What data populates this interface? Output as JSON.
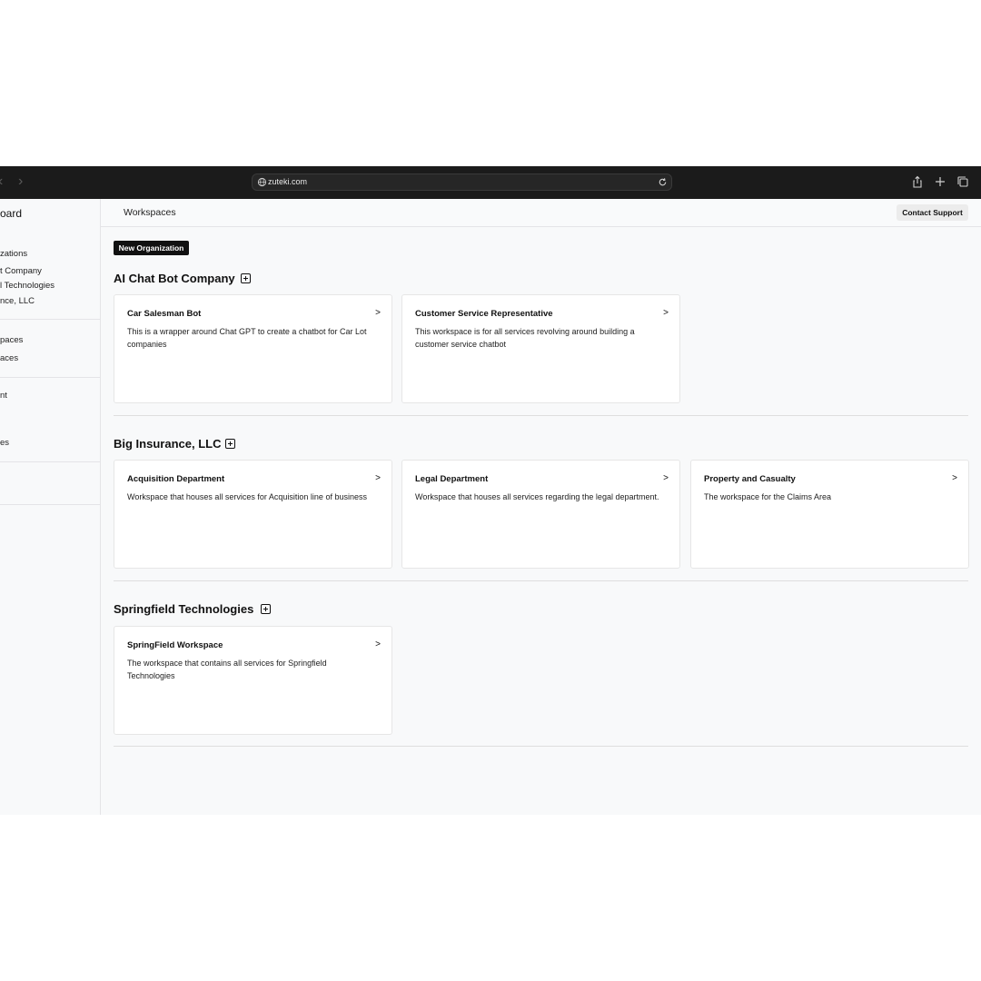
{
  "browser": {
    "url": "zuteki.com"
  },
  "sidebar": {
    "title": "oard",
    "items": [
      "zations",
      "t Company",
      "l Technologies",
      "nce, LLC",
      "paces",
      "aces",
      "nt",
      "es"
    ]
  },
  "header": {
    "title": "Workspaces",
    "contact_label": "Contact Support"
  },
  "new_org_label": "New Organization",
  "orgs": [
    {
      "name": "AI Chat Bot Company",
      "cards": [
        {
          "title": "Car Salesman Bot",
          "desc": "This is a wrapper around Chat GPT to create a chatbot for Car Lot companies"
        },
        {
          "title": "Customer Service Representative",
          "desc": "This workspace is for all services revolving around building a customer service chatbot"
        }
      ]
    },
    {
      "name": "Big Insurance, LLC",
      "cards": [
        {
          "title": "Acquisition Department",
          "desc": "Workspace that houses all services for Acquisition line of business"
        },
        {
          "title": "Legal Department",
          "desc": "Workspace that houses all services regarding the legal department."
        },
        {
          "title": "Property and Casualty",
          "desc": "The workspace for the Claims Area"
        }
      ]
    },
    {
      "name": "Springfield Technologies",
      "cards": [
        {
          "title": "SpringField Workspace",
          "desc": "The workspace that contains all services for Springfield Technologies"
        }
      ]
    }
  ],
  "chevron": ">"
}
